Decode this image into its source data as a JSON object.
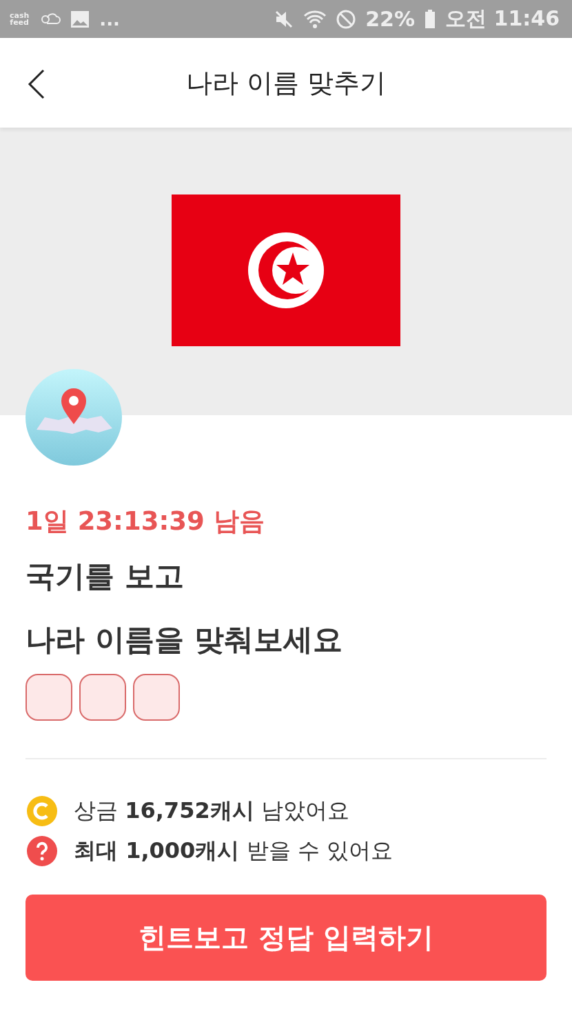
{
  "status_bar": {
    "logo_top": "cash",
    "logo_bottom": "feed",
    "more": "...",
    "battery": "22%",
    "time": "오전 11:46"
  },
  "header": {
    "title": "나라 이름 맞추기"
  },
  "quiz": {
    "timer": "1일 23:13:39 남음",
    "question_lines": [
      "국기를 보고",
      "나라 이름을 맞춰보세요"
    ],
    "answer_slots": [
      {
        "filled": false
      },
      {
        "filled": false
      },
      {
        "filled": false
      }
    ]
  },
  "info": [
    {
      "kind": "coin",
      "text": "상금 **16,752캐시** 남았어요"
    },
    {
      "kind": "question",
      "text": "**최대 1,000캐시** 받을 수 있어요"
    }
  ],
  "button": {
    "label": "힌트보고 정답 입력하기"
  }
}
